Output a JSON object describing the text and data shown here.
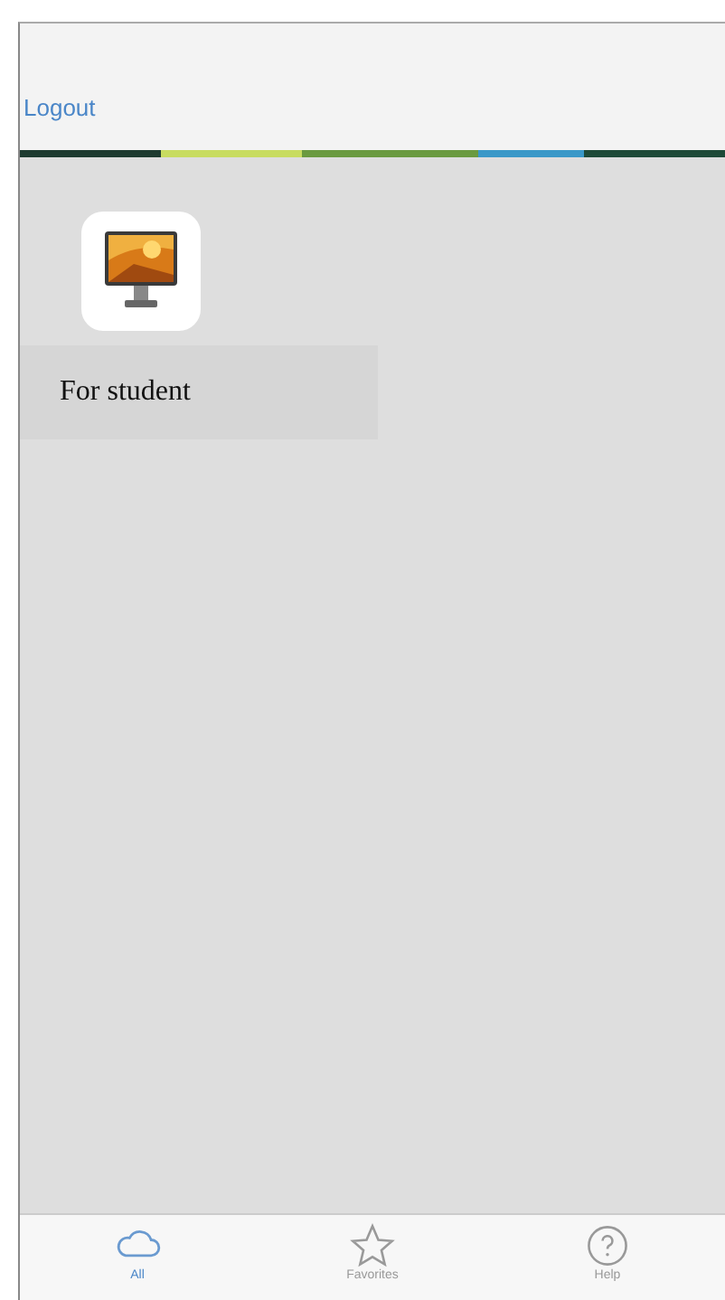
{
  "header": {
    "logout": "Logout"
  },
  "apps": [
    {
      "kind": "picture",
      "label": "For student"
    }
  ],
  "tabs": [
    {
      "label": "All",
      "kind": "cloud",
      "selected": true
    },
    {
      "label": "Favorites",
      "kind": "star",
      "selected": false
    },
    {
      "label": "Help",
      "kind": "help",
      "selected": false
    }
  ]
}
